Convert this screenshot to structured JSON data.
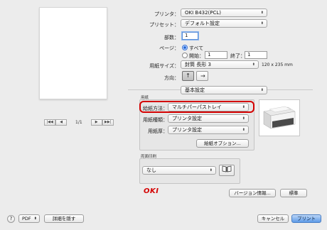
{
  "preview": {
    "page_indicator": "1/1",
    "nav": {
      "first": "|◀◀",
      "prev": "◀",
      "next": "▶",
      "last": "▶▶|"
    }
  },
  "form": {
    "printer_label": "プリンタ：",
    "printer_value": "OKI B432(PCL)",
    "preset_label": "プリセット：",
    "preset_value": "デフォルト設定",
    "copies_label": "部数：",
    "copies_value": "1",
    "pages_label": "ページ：",
    "pages_all_label": "すべて",
    "pages_from_label": "開始：",
    "pages_from_value": "1",
    "pages_to_label": "終了：",
    "pages_to_value": "1",
    "paper_size_label": "用紙サイズ：",
    "paper_size_value": "封筒 長形 3",
    "paper_size_dims": "120 x 235 mm",
    "orientation_label": "方向：",
    "panel_value": "基本設定"
  },
  "paper_group": {
    "title": "用紙",
    "feed_label": "給紙方法：",
    "feed_value": "マルチパーパストレイ",
    "media_type_label": "用紙種類：",
    "media_type_value": "プリンタ設定",
    "media_weight_label": "用紙厚：",
    "media_weight_value": "プリンタ設定",
    "feed_options_button": "給紙オプション..."
  },
  "duplex_group": {
    "title": "両面印刷",
    "value": "なし"
  },
  "brand": {
    "logo": "OKI"
  },
  "buttons": {
    "version_info": "バージョン情報...",
    "standard": "標準",
    "help": "?",
    "pdf": "PDF",
    "hide_details": "詳細を隠す",
    "cancel": "キャンセル",
    "print": "プリント"
  },
  "icons": {
    "popup_arrows": "⬍",
    "orient_portrait": "↑",
    "orient_landscape": "↑",
    "book": "📖"
  },
  "colors": {
    "highlight": "#d40000",
    "primary_button": "#5d9ae7",
    "logo": "#d40000"
  }
}
